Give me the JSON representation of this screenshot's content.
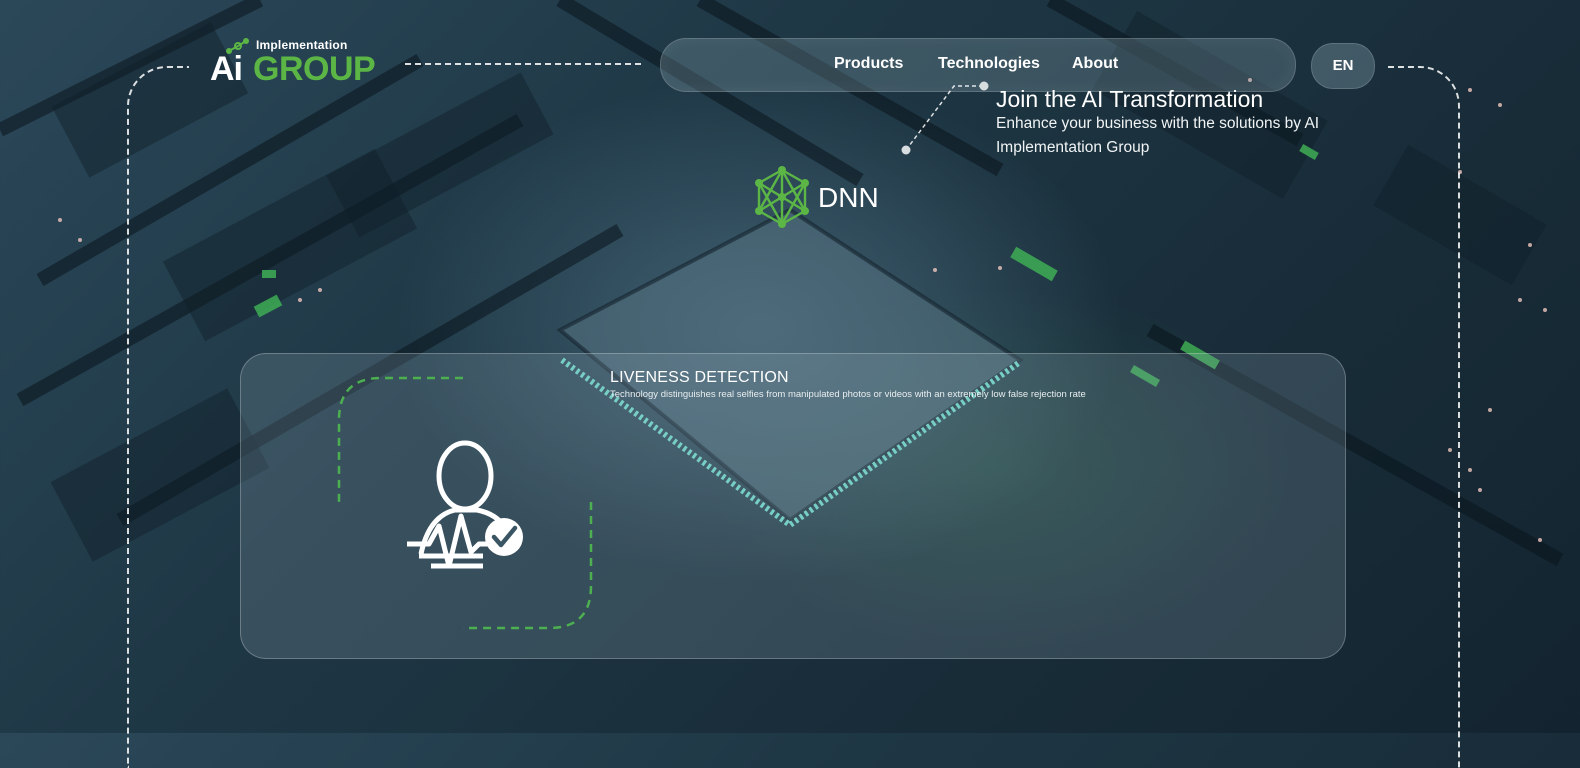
{
  "brand": {
    "logo_top": "Implementation",
    "logo_ai": "Ai",
    "logo_group": "GROUP",
    "accent": "#5cb646"
  },
  "nav": {
    "items": [
      {
        "label": "Products"
      },
      {
        "label": "Technologies"
      },
      {
        "label": "About"
      }
    ],
    "language": "EN"
  },
  "cta": {
    "title": "Join the AI Transformation",
    "description": "Enhance your business with the solutions by AI Implementation Group"
  },
  "technology": {
    "name": "DNN",
    "icon": "neural-network-icon"
  },
  "feature": {
    "title": "LIVENESS DETECTION",
    "description": "Technology distinguishes real selfies from manipulated photos or videos with an extremely low false rejection rate",
    "icon": "liveness-user-check-icon"
  }
}
